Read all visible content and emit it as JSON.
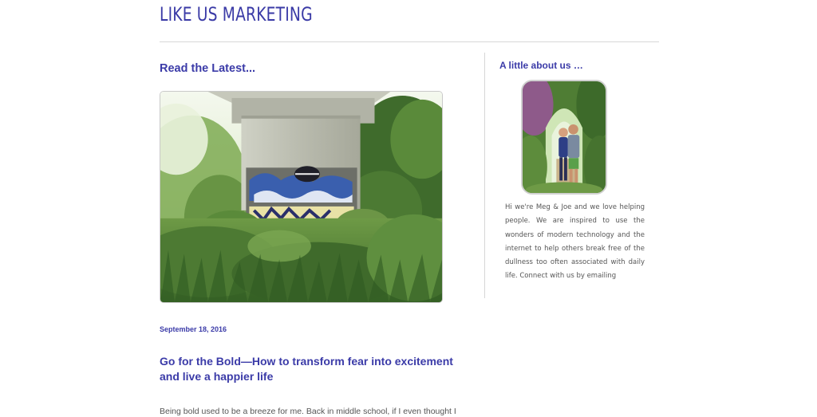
{
  "site": {
    "title": "LIKE US MARKETING"
  },
  "main": {
    "section_heading": "Read the Latest...",
    "post": {
      "date": "September 18, 2016",
      "title": "Go for the Bold—How to transform fear into excitement and live a happier life",
      "excerpt": "Being bold used to be a breeze for me. Back in middle school, if I even thought I"
    }
  },
  "sidebar": {
    "heading": "A little about us …",
    "about_text": "Hi we're Meg & Joe and we love helping people. We are inspired to use the wonders of modern technology and the internet to help others break free of the dullness too often associated with daily life. Connect with us by emailing"
  },
  "colors": {
    "accent": "#3b3ba8",
    "divider": "#d8d8d8",
    "body_text": "#555555"
  }
}
